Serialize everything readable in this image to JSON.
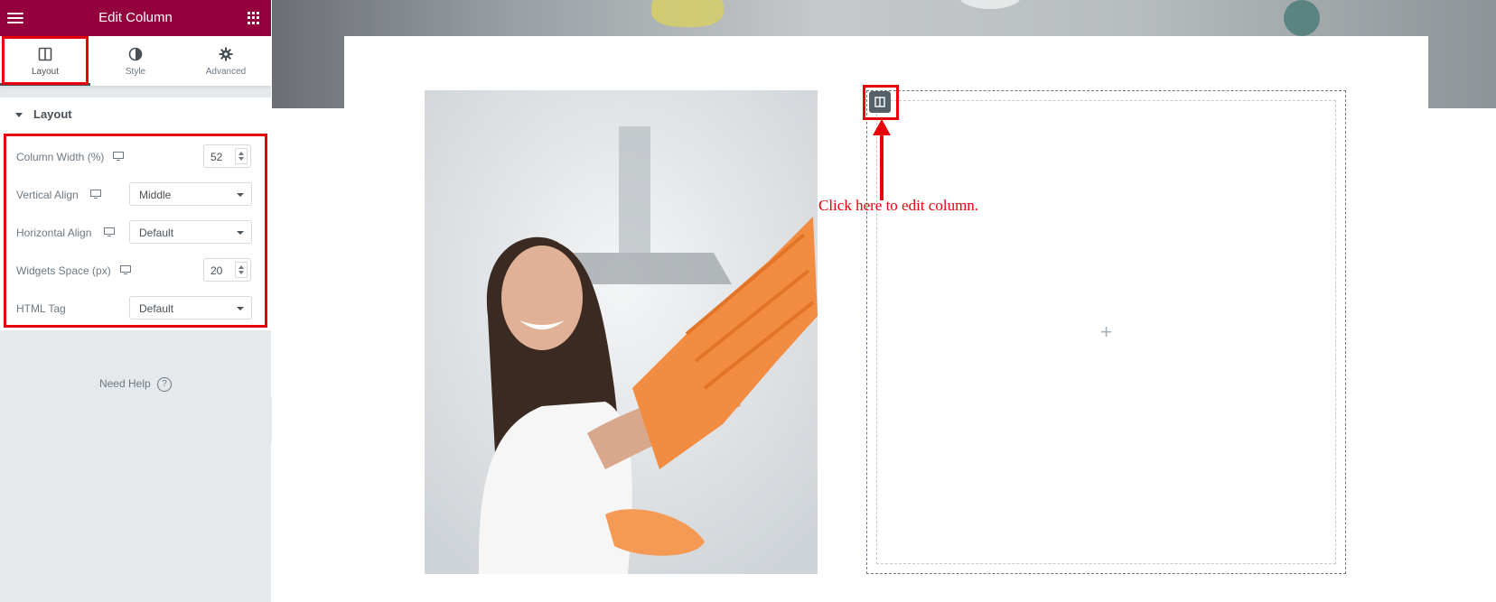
{
  "panel": {
    "title": "Edit Column",
    "tabs": [
      {
        "label": "Layout",
        "icon": "columns-icon",
        "active": true
      },
      {
        "label": "Style",
        "icon": "half-circle-icon",
        "active": false
      },
      {
        "label": "Advanced",
        "icon": "gear-icon",
        "active": false
      }
    ],
    "section_title": "Layout",
    "controls": {
      "column_width": {
        "label": "Column Width (%)",
        "value": "52"
      },
      "vertical_align": {
        "label": "Vertical Align",
        "value": "Middle"
      },
      "horizontal_align": {
        "label": "Horizontal Align",
        "value": "Default"
      },
      "widgets_space": {
        "label": "Widgets Space (px)",
        "value": "20"
      },
      "html_tag": {
        "label": "HTML Tag",
        "value": "Default"
      }
    },
    "need_help": "Need Help",
    "help_icon_glyph": "?"
  },
  "canvas": {
    "add_glyph": "+",
    "annotation": "Click here to edit column."
  },
  "colors": {
    "topbar": "#93003c",
    "highlight": "#e8000b",
    "sidebar_bg": "#e6e9ec"
  }
}
